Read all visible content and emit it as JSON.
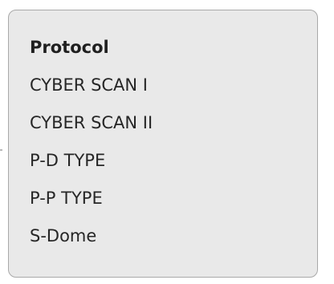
{
  "menu": {
    "header": "Protocol",
    "items": [
      {
        "label": "CYBER SCAN I"
      },
      {
        "label": "CYBER SCAN II"
      },
      {
        "label": "P-D TYPE"
      },
      {
        "label": "P-P TYPE"
      },
      {
        "label": "S-Dome"
      }
    ]
  },
  "colors": {
    "panel_background": "#e9e9e9",
    "panel_border": "#a9a9a9",
    "text": "#262626"
  }
}
